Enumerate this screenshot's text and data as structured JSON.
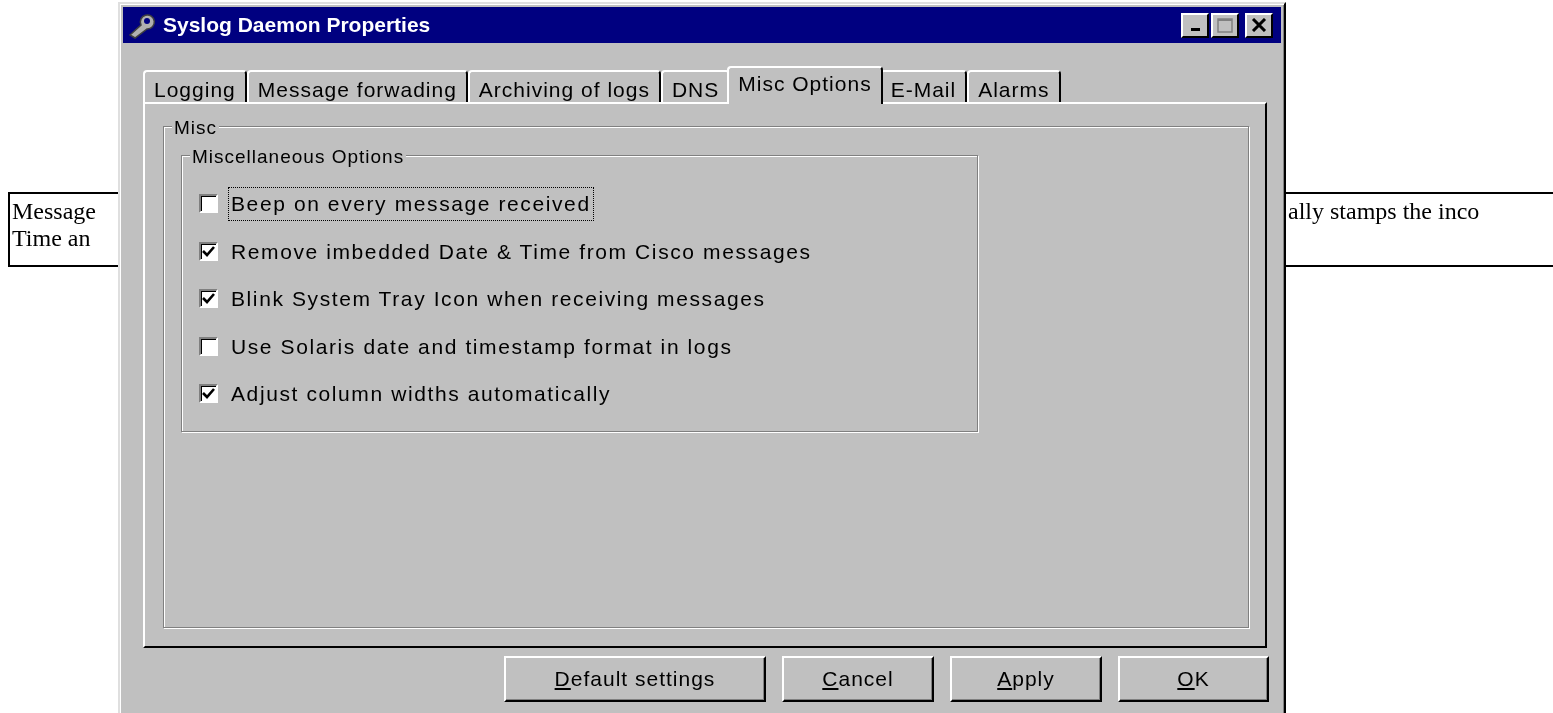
{
  "page": {
    "cell_left_lines": [
      "Message",
      "Time an"
    ],
    "cell_right_lines": [
      "ally stamps the inco"
    ]
  },
  "window": {
    "title": "Syslog Daemon Properties",
    "controls": [
      {
        "kind": "minimize"
      },
      {
        "kind": "maximize"
      },
      {
        "kind": "close"
      }
    ]
  },
  "tabs": [
    {
      "label": "Logging",
      "selected": false
    },
    {
      "label": "Message forwading",
      "selected": false
    },
    {
      "label": "Archiving of logs",
      "selected": false
    },
    {
      "label": "DNS",
      "selected": false
    },
    {
      "label": "Misc Options",
      "selected": true
    },
    {
      "label": "E-Mail",
      "selected": false
    },
    {
      "label": "Alarms",
      "selected": false
    }
  ],
  "group": {
    "title": "Misc",
    "subgroup": {
      "title": "Miscellaneous Options",
      "options": [
        {
          "label": "Beep on every message received",
          "checked": false,
          "focused": true
        },
        {
          "label": "Remove imbedded Date & Time from Cisco messages",
          "checked": true,
          "focused": false
        },
        {
          "label": "Blink System Tray Icon when receiving messages",
          "checked": true,
          "focused": false
        },
        {
          "label": "Use Solaris date and timestamp format in logs",
          "checked": false,
          "focused": false
        },
        {
          "label": "Adjust column widths automatically",
          "checked": true,
          "focused": false
        }
      ]
    }
  },
  "buttons": [
    {
      "label": "Default settings",
      "mnemonic": true
    },
    {
      "label": "Cancel",
      "mnemonic": true
    },
    {
      "label": "Apply",
      "mnemonic": true
    },
    {
      "label": "OK",
      "mnemonic": true
    }
  ]
}
